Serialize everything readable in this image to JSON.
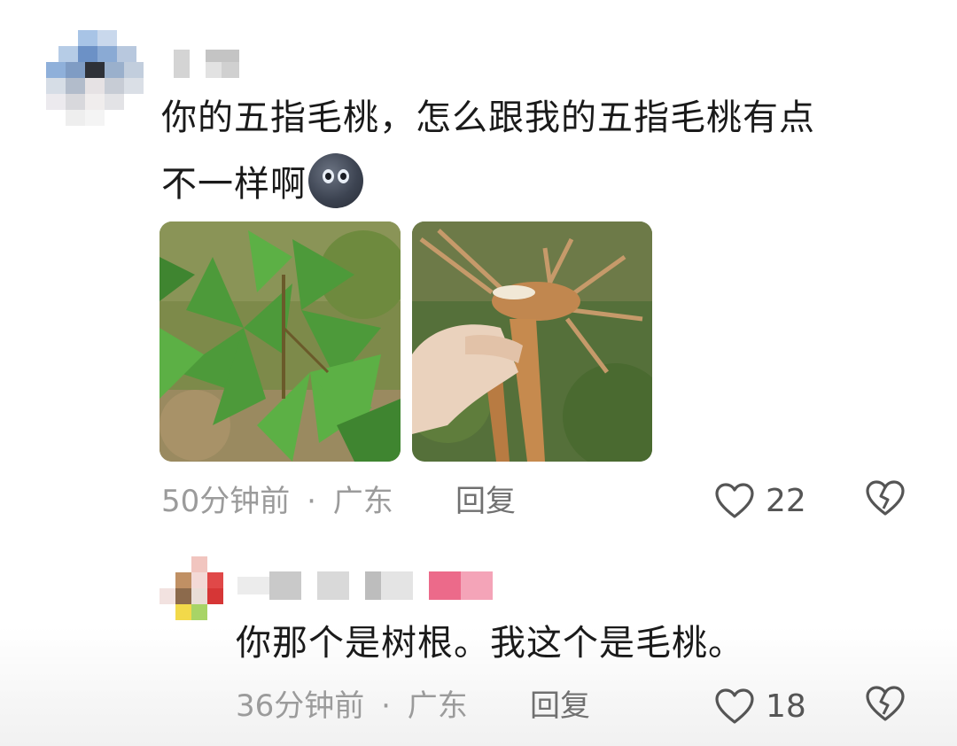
{
  "comments": [
    {
      "text_line1": "你的五指毛桃，怎么跟我的五指毛桃有点",
      "text_line2": "不一样啊",
      "emoji": "new-moon-face-emoji",
      "images": [
        "plant-leaves-photo",
        "root-in-hand-photo"
      ],
      "time": "50分钟前",
      "separator": "·",
      "location": "广东",
      "reply_label": "回复",
      "likes": "22"
    },
    {
      "text": "你那个是树根。我这个是毛桃。",
      "time": "36分钟前",
      "separator": "·",
      "location": "广东",
      "reply_label": "回复",
      "likes": "18"
    }
  ],
  "icons": {
    "like": "heart-outline-icon",
    "dislike": "broken-heart-icon"
  },
  "colors": {
    "meta_text": "#9b9b9b",
    "reply_text": "#707070",
    "icon_stroke": "#555555"
  }
}
